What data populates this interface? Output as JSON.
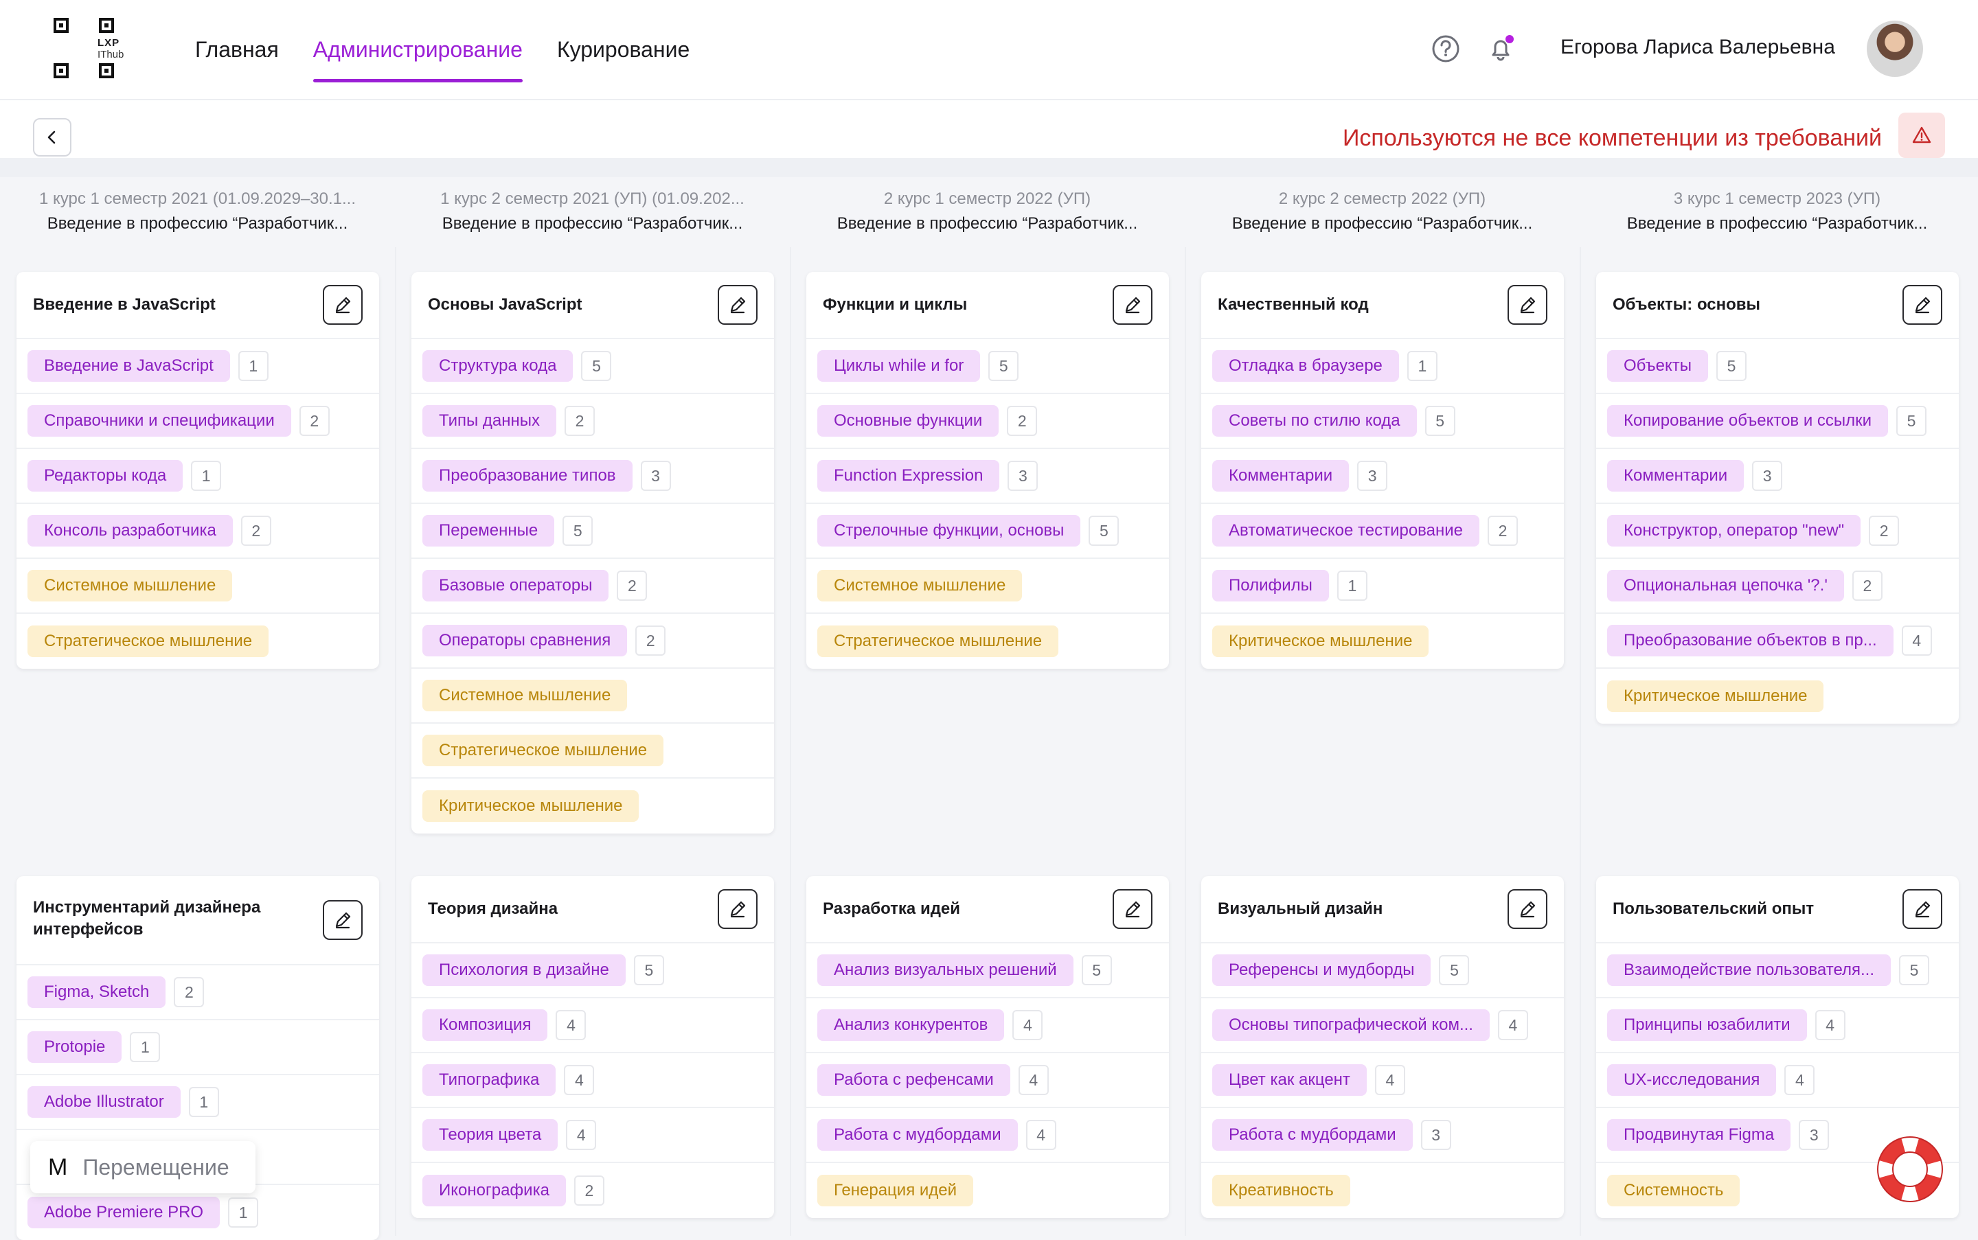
{
  "header": {
    "logo": {
      "line1": "LXP",
      "line2": "IThub"
    },
    "nav": [
      {
        "label": "Главная",
        "active": false
      },
      {
        "label": "Администрирование",
        "active": true
      },
      {
        "label": "Курирование",
        "active": false
      }
    ],
    "icons": [
      "help-circle-icon",
      "bell-icon"
    ],
    "user_name": "Егорова Лариса Валерьевна",
    "accent_color": "#9b1fd6"
  },
  "toolbar": {
    "warning_text": "Используются не все компетенции из требований",
    "warning_color": "#c62828"
  },
  "columns": [
    {
      "line1": "1 курс 1 семестр 2021 (01.09.2029–30.1...",
      "line2": "Введение в профессию “Разработчик..."
    },
    {
      "line1": "1 курс 2 семестр 2021 (УП) (01.09.202...",
      "line2": "Введение в профессию “Разработчик..."
    },
    {
      "line1": "2 курс 1 семестр 2022 (УП)",
      "line2": "Введение в профессию “Разработчик..."
    },
    {
      "line1": "2 курс 2 семестр 2022 (УП)",
      "line2": "Введение в профессию “Разработчик..."
    },
    {
      "line1": "3 курс 1 семестр 2023 (УП)",
      "line2": "Введение в профессию “Разработчик..."
    }
  ],
  "cards": [
    {
      "title": "Введение в JavaScript",
      "items": [
        {
          "label": "Введение в JavaScript",
          "type": "skill",
          "count": "1"
        },
        {
          "label": "Справочники и спецификации",
          "type": "skill",
          "count": "2"
        },
        {
          "label": "Редакторы кода",
          "type": "skill",
          "count": "1"
        },
        {
          "label": "Консоль разработчика",
          "type": "skill",
          "count": "2"
        },
        {
          "label": "Системное мышление",
          "type": "soft"
        },
        {
          "label": "Стратегическое мышление",
          "type": "soft"
        }
      ]
    },
    {
      "title": "Основы JavaScript",
      "items": [
        {
          "label": "Структура кода",
          "type": "skill",
          "count": "5"
        },
        {
          "label": "Типы данных",
          "type": "skill",
          "count": "2"
        },
        {
          "label": "Преобразование типов",
          "type": "skill",
          "count": "3"
        },
        {
          "label": "Переменные",
          "type": "skill",
          "count": "5"
        },
        {
          "label": "Базовые операторы",
          "type": "skill",
          "count": "2"
        },
        {
          "label": "Операторы сравнения",
          "type": "skill",
          "count": "2"
        },
        {
          "label": "Системное мышление",
          "type": "soft"
        },
        {
          "label": "Стратегическое мышление",
          "type": "soft"
        },
        {
          "label": "Критическое мышление",
          "type": "soft"
        }
      ]
    },
    {
      "title": "Функции и циклы",
      "items": [
        {
          "label": "Циклы while и for",
          "type": "skill",
          "count": "5"
        },
        {
          "label": "Основные функции",
          "type": "skill",
          "count": "2"
        },
        {
          "label": "Function Expression",
          "type": "skill",
          "count": "3"
        },
        {
          "label": "Стрелочные функции, основы",
          "type": "skill",
          "count": "5"
        },
        {
          "label": "Системное мышление",
          "type": "soft"
        },
        {
          "label": "Стратегическое мышление",
          "type": "soft"
        }
      ]
    },
    {
      "title": "Качественный код",
      "items": [
        {
          "label": "Отладка в браузере",
          "type": "skill",
          "count": "1"
        },
        {
          "label": "Советы по стилю кода",
          "type": "skill",
          "count": "5"
        },
        {
          "label": "Комментарии",
          "type": "skill",
          "count": "3"
        },
        {
          "label": "Автоматическое тестирование",
          "type": "skill",
          "count": "2"
        },
        {
          "label": "Полифилы",
          "type": "skill",
          "count": "1"
        },
        {
          "label": "Критическое мышление",
          "type": "soft"
        }
      ]
    },
    {
      "title": "Объекты: основы",
      "items": [
        {
          "label": "Объекты",
          "type": "skill",
          "count": "5"
        },
        {
          "label": "Копирование объектов и ссылки",
          "type": "skill",
          "count": "5"
        },
        {
          "label": "Комментарии",
          "type": "skill",
          "count": "3"
        },
        {
          "label": "Конструктор, оператор \"new\"",
          "type": "skill",
          "count": "2"
        },
        {
          "label": "Опциональная цепочка '?.'",
          "type": "skill",
          "count": "2"
        },
        {
          "label": "Преобразование объектов в пр...",
          "type": "skill",
          "count": "4"
        },
        {
          "label": "Критическое мышление",
          "type": "soft"
        }
      ]
    },
    {
      "title": "Инструментарий дизайнера интерфейсов",
      "items": [
        {
          "label": "Figma, Sketch",
          "type": "skill",
          "count": "2"
        },
        {
          "label": "Protopie",
          "type": "skill",
          "count": "1"
        },
        {
          "label": "Adobe Illustrator",
          "type": "skill",
          "count": "1"
        },
        {
          "label": "",
          "type": "skill",
          "count": ""
        },
        {
          "label": "Adobe Premiere PRO",
          "type": "skill",
          "count": "1"
        }
      ]
    },
    {
      "title": "Теория дизайна",
      "items": [
        {
          "label": "Психология в дизайне",
          "type": "skill",
          "count": "5"
        },
        {
          "label": "Композиция",
          "type": "skill",
          "count": "4"
        },
        {
          "label": "Типографика",
          "type": "skill",
          "count": "4"
        },
        {
          "label": "Теория цвета",
          "type": "skill",
          "count": "4"
        },
        {
          "label": "Иконографика",
          "type": "skill",
          "count": "2"
        }
      ]
    },
    {
      "title": "Разработка идей",
      "items": [
        {
          "label": "Анализ визуальных решений",
          "type": "skill",
          "count": "5"
        },
        {
          "label": "Анализ конкурентов",
          "type": "skill",
          "count": "4"
        },
        {
          "label": "Работа с рефенсами",
          "type": "skill",
          "count": "4"
        },
        {
          "label": "Работа с мудбордами",
          "type": "skill",
          "count": "4"
        },
        {
          "label": "Генерация идей",
          "type": "soft"
        }
      ]
    },
    {
      "title": "Визуальный дизайн",
      "items": [
        {
          "label": "Референсы и мудборды",
          "type": "skill",
          "count": "5"
        },
        {
          "label": "Основы типографической ком...",
          "type": "skill",
          "count": "4"
        },
        {
          "label": "Цвет как акцент",
          "type": "skill",
          "count": "4"
        },
        {
          "label": "Работа с мудбордами",
          "type": "skill",
          "count": "3"
        },
        {
          "label": "Креативность",
          "type": "soft"
        }
      ]
    },
    {
      "title": "Пользовательский опыт",
      "items": [
        {
          "label": "Взаимодействие пользователя...",
          "type": "skill",
          "count": "5"
        },
        {
          "label": "Принципы юзабилити",
          "type": "skill",
          "count": "4"
        },
        {
          "label": "UX-исследования",
          "type": "skill",
          "count": "4"
        },
        {
          "label": "Продвинутая Figma",
          "type": "skill",
          "count": "3"
        },
        {
          "label": "Системность",
          "type": "soft"
        }
      ]
    }
  ],
  "tooltip": {
    "key": "M",
    "label": "Перемещение"
  },
  "colors": {
    "skill_bg": "#f3dcfb",
    "skill_text": "#8a1fc0",
    "soft_bg": "#fdf0cf",
    "soft_text": "#b8860b",
    "warning_bg": "#fbe3e3"
  }
}
